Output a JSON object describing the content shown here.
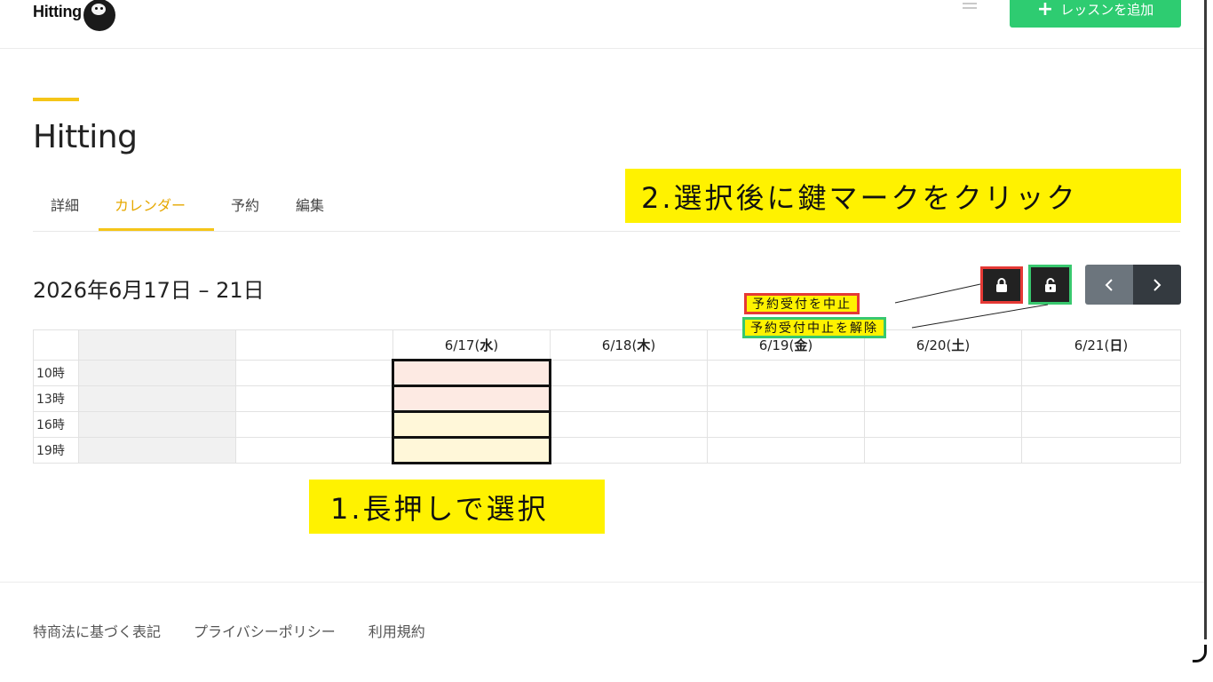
{
  "header": {
    "logo_text": "Hitting",
    "add_button_label": "レッスンを追加",
    "add_button_plus": "+"
  },
  "page": {
    "title": "Hitting",
    "tabs": [
      {
        "label": "詳細",
        "active": false
      },
      {
        "label": "カレンダー",
        "active": true
      },
      {
        "label": "予約",
        "active": false
      },
      {
        "label": "編集",
        "active": false
      }
    ],
    "date_range": "2026年6月17日 – 21日"
  },
  "annotations": {
    "step2": "2.選択後に鍵マークをクリック",
    "step1": "1.長押しで選択",
    "stop_label": "予約受付を中止",
    "release_label": "予約受付中止を解除"
  },
  "calendar": {
    "days": [
      {
        "date": "6/17",
        "dow": "水"
      },
      {
        "date": "6/18",
        "dow": "木"
      },
      {
        "date": "6/19",
        "dow": "金"
      },
      {
        "date": "6/20",
        "dow": "土"
      },
      {
        "date": "6/21",
        "dow": "日"
      }
    ],
    "times": [
      "10時",
      "13時",
      "16時",
      "19時"
    ]
  },
  "footer": {
    "links": [
      "特商法に基づく表記",
      "プライバシーポリシー",
      "利用規約"
    ]
  },
  "colors": {
    "accent": "#f5c518",
    "primary_green": "#2ecc71",
    "annotation_yellow": "#fff200",
    "stop_border": "#e53935",
    "release_border": "#38c86e"
  },
  "icons": {
    "lock": "lock-icon",
    "unlock": "unlock-icon",
    "prev": "chevron-left-icon",
    "next": "chevron-right-icon",
    "menu": "hamburger-icon"
  }
}
